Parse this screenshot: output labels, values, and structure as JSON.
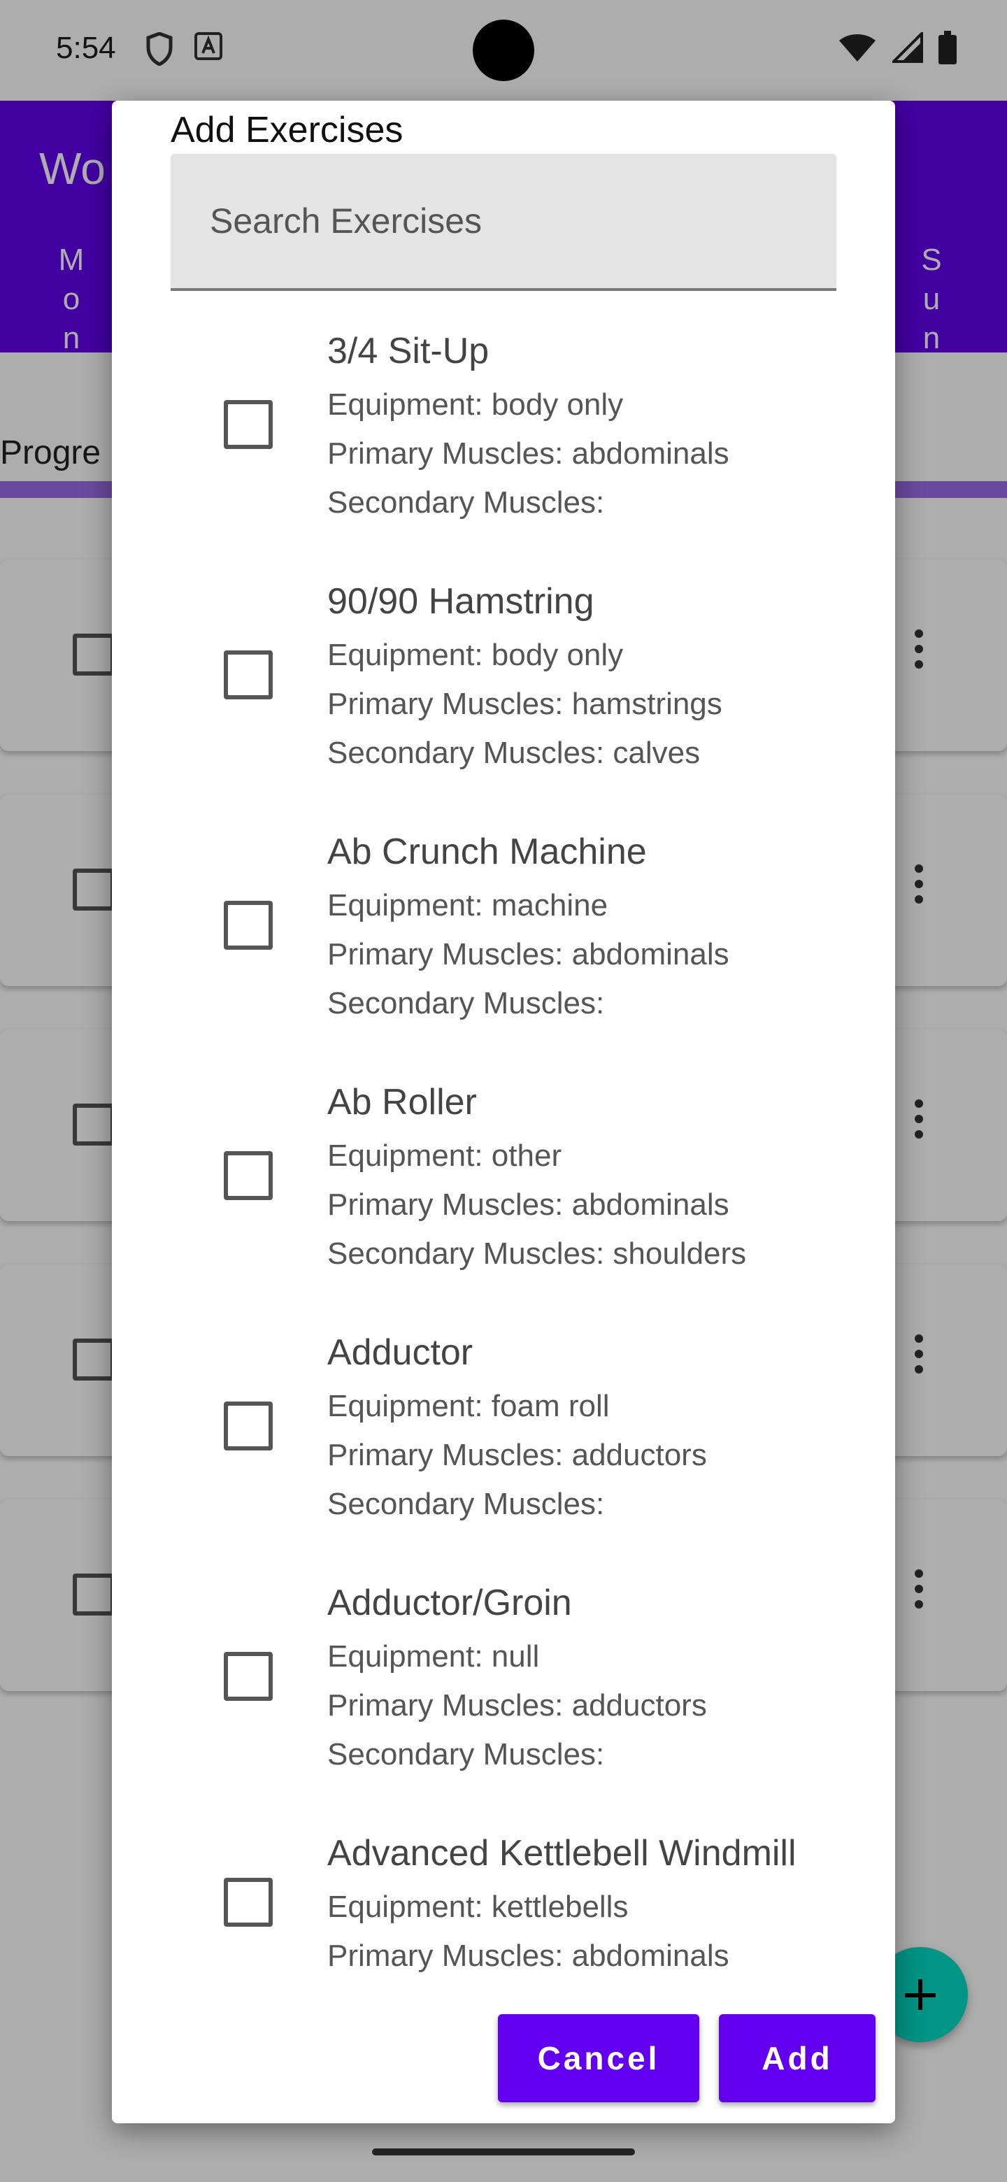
{
  "status_bar": {
    "time": "5:54",
    "left_icons": [
      "shield-icon",
      "text-a-icon"
    ],
    "right_icons": [
      "wifi-icon",
      "signal-icon",
      "battery-icon"
    ]
  },
  "app_bar": {
    "title": "Wo",
    "days": {
      "mon": [
        "M",
        "o",
        "n"
      ],
      "sun": [
        "S",
        "u",
        "n"
      ]
    },
    "color": "#6200ee"
  },
  "progress": {
    "label": "Progre",
    "fraction": 1.0
  },
  "dialog": {
    "title": "Add Exercises",
    "search_placeholder": "Search Exercises",
    "exercises": [
      {
        "name": "3/4 Sit-Up",
        "equipment": "Equipment: body only",
        "primary": "Primary Muscles: abdominals",
        "secondary": "Secondary Muscles:"
      },
      {
        "name": "90/90 Hamstring",
        "equipment": "Equipment: body only",
        "primary": "Primary Muscles: hamstrings",
        "secondary": "Secondary Muscles: calves"
      },
      {
        "name": "Ab Crunch Machine",
        "equipment": "Equipment: machine",
        "primary": "Primary Muscles: abdominals",
        "secondary": "Secondary Muscles:"
      },
      {
        "name": "Ab Roller",
        "equipment": "Equipment: other",
        "primary": "Primary Muscles: abdominals",
        "secondary": "Secondary Muscles: shoulders"
      },
      {
        "name": "Adductor",
        "equipment": "Equipment: foam roll",
        "primary": "Primary Muscles: adductors",
        "secondary": "Secondary Muscles:"
      },
      {
        "name": "Adductor/Groin",
        "equipment": "Equipment: null",
        "primary": "Primary Muscles: adductors",
        "secondary": "Secondary Muscles:"
      },
      {
        "name": "Advanced Kettlebell Windmill",
        "equipment": "Equipment: kettlebells",
        "primary": "Primary Muscles: abdominals",
        "secondary": ""
      }
    ],
    "cancel_label": "Cancel",
    "add_label": "Add"
  },
  "colors": {
    "accent": "#6200ee",
    "fab": "#03dac5"
  }
}
